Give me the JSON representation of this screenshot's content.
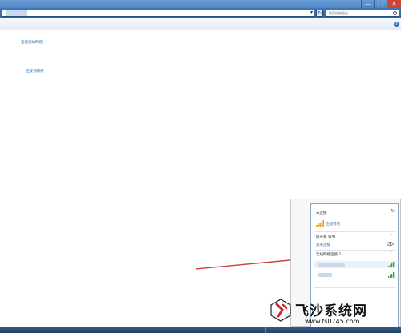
{
  "window": {
    "address_placeholder": "",
    "search_placeholder": "搜索控制面板",
    "help_label": "?",
    "minimize_glyph": "—",
    "maximize_glyph": "□",
    "close_glyph": "✕"
  },
  "left_pane": {
    "links": [
      "查看活动网络",
      "连接到网络"
    ]
  },
  "flyout": {
    "title": "未连接",
    "status": "连接可用",
    "sections": [
      {
        "label": "拨号和 VPN",
        "expanded": true
      },
      {
        "label": "无线网络连接 2",
        "expanded": true
      }
    ],
    "vpn_item": "宽带连接",
    "networks_shown": 2
  },
  "watermark": {
    "title": "飞沙系统网",
    "url": "www.fs0745.com"
  },
  "colors": {
    "link": "#1c5fae",
    "titlebar": "#4f86c6",
    "arrow": "#d0403a",
    "signal": "#3ea33a"
  }
}
